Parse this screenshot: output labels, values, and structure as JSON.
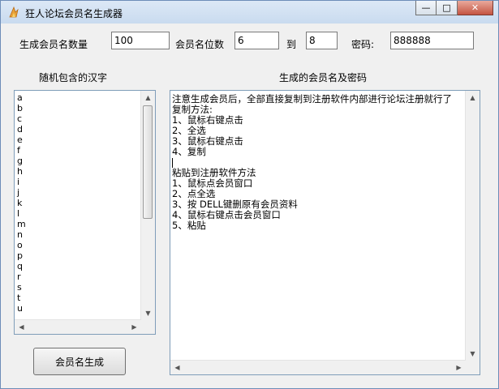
{
  "window": {
    "title": "狂人论坛会员名生成器",
    "min_icon": "—",
    "max_icon": "□",
    "close_icon": "✕"
  },
  "form": {
    "count_label": "生成会员名数量",
    "count_value": "100",
    "digits_label": "会员名位数",
    "digits_from": "6",
    "to_label": "到",
    "digits_to": "8",
    "password_label": "密码:",
    "password_value": "888888"
  },
  "left_panel": {
    "header": "随机包含的汉字",
    "items": [
      "a",
      "b",
      "c",
      "d",
      "e",
      "f",
      "g",
      "h",
      "i",
      "j",
      "k",
      "l",
      "m",
      "n",
      "o",
      "p",
      "q",
      "r",
      "s",
      "t",
      "u"
    ]
  },
  "right_panel": {
    "header": "生成的会员名及密码",
    "lines": [
      "注意生成会员后，全部直接复制到注册软件内部进行论坛注册就行了",
      "",
      "复制方法:",
      "1、鼠标右键点击",
      "2、全选",
      "3、鼠标右键点击",
      "4、复制",
      "",
      "",
      "",
      "",
      "粘贴到注册软件方法",
      "",
      "1、鼠标点会员窗口",
      "2、点全选",
      "3、按 DELL键删原有会员资料",
      "4、鼠标右键点击会员窗口",
      "5、粘贴"
    ]
  },
  "generate_button": "会员名生成",
  "colors": {
    "titlebar": "#d3e2f3",
    "close_button": "#c45542",
    "panel_border": "#7f9db9"
  }
}
